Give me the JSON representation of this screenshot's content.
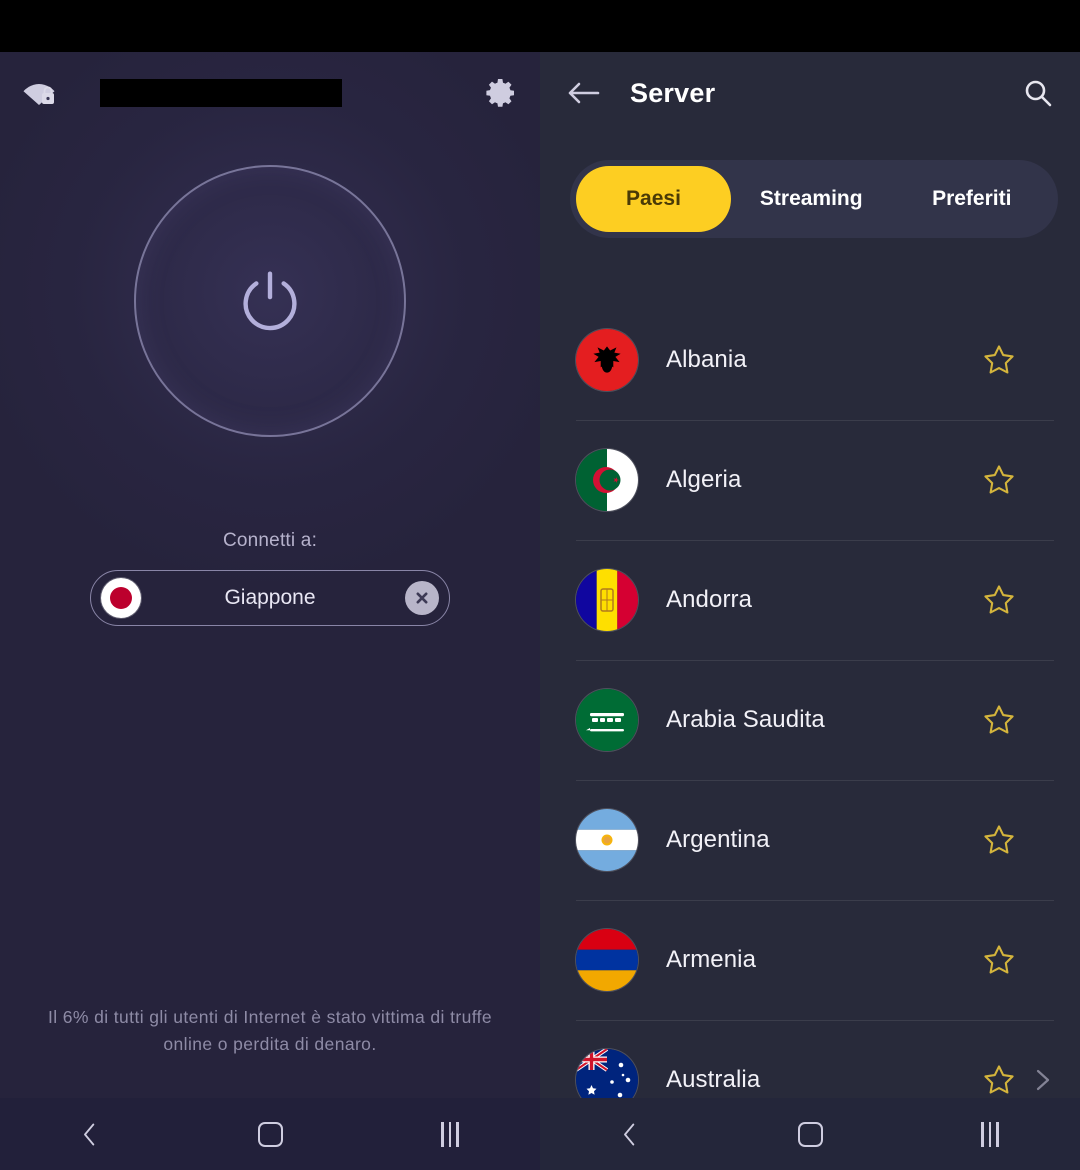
{
  "statusbar": {
    "redacted": true
  },
  "left_panel": {
    "appbar": {
      "wifi_icon": "wifi-lock-icon",
      "settings_icon": "gear-icon"
    },
    "power_button": {
      "icon": "power-icon",
      "state": "disconnected"
    },
    "connect_label": "Connetti a:",
    "selected_server": {
      "name": "Giappone",
      "flag": "jp",
      "clear_icon": "close-circle-icon"
    },
    "tip": "Il 6% di tutti gli utenti di Internet è stato vittima di truffe online o perdita di denaro."
  },
  "right_panel": {
    "appbar": {
      "back_icon": "arrow-left-icon",
      "title": "Server",
      "search_icon": "search-icon"
    },
    "tabs": [
      {
        "label": "Paesi",
        "active": true
      },
      {
        "label": "Streaming",
        "active": false
      },
      {
        "label": "Preferiti",
        "active": false
      }
    ],
    "servers": [
      {
        "name": "Albania",
        "flag": "al",
        "favorite": false,
        "has_chevron": false
      },
      {
        "name": "Algeria",
        "flag": "dz",
        "favorite": false,
        "has_chevron": false
      },
      {
        "name": "Andorra",
        "flag": "ad",
        "favorite": false,
        "has_chevron": false
      },
      {
        "name": "Arabia Saudita",
        "flag": "sa",
        "favorite": false,
        "has_chevron": false
      },
      {
        "name": "Argentina",
        "flag": "ar",
        "favorite": false,
        "has_chevron": false
      },
      {
        "name": "Armenia",
        "flag": "am",
        "favorite": false,
        "has_chevron": false
      },
      {
        "name": "Australia",
        "flag": "au",
        "favorite": false,
        "has_chevron": true
      }
    ]
  },
  "navbar": {
    "back_icon": "nav-back-icon",
    "home_icon": "nav-home-icon",
    "recents_icon": "nav-recents-icon"
  },
  "colors": {
    "left_bg": "#26233c",
    "right_bg": "#282a3a",
    "accent_yellow": "#fdce22",
    "star_gold": "#d4b43c",
    "tab_track": "#32344a",
    "text_primary": "#f2f1f7",
    "text_muted": "#8e8ba6"
  }
}
